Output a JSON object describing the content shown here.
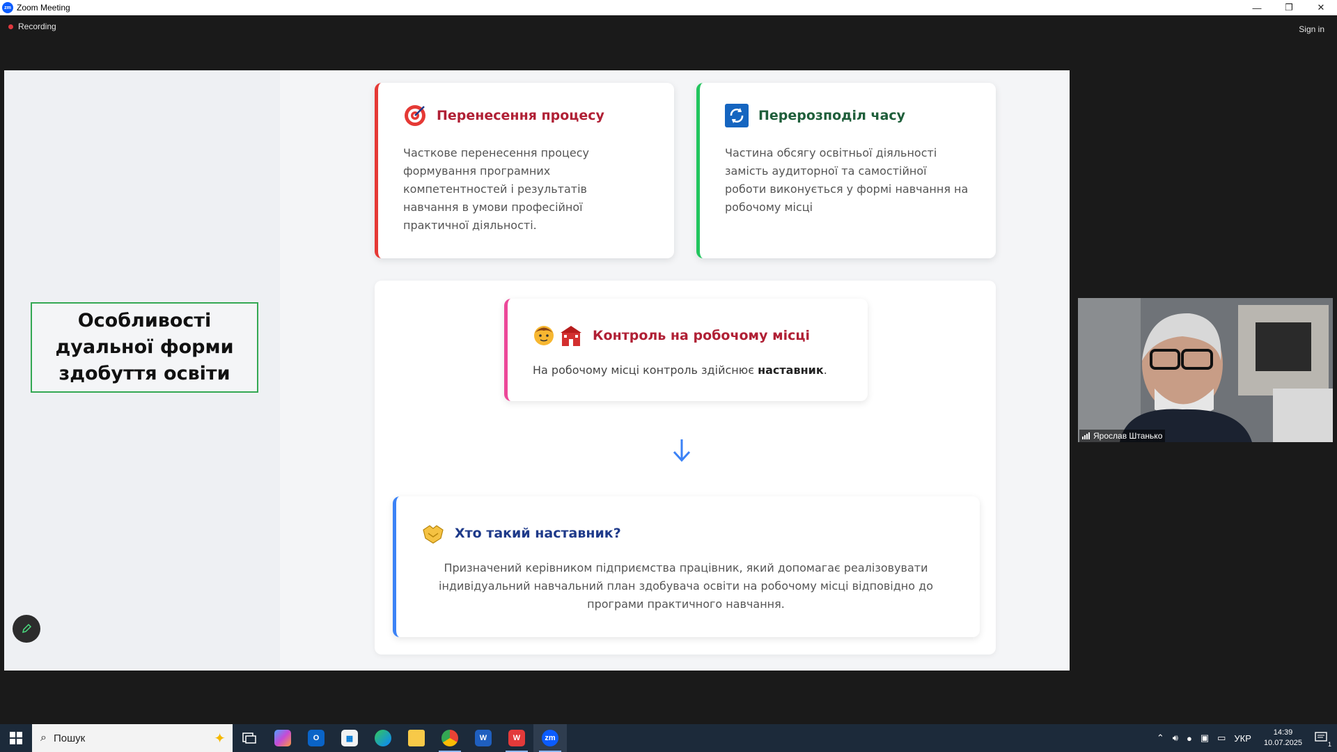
{
  "window": {
    "app_title": "Zoom Meeting",
    "logo_text": "zm",
    "minimize_label": "—",
    "restore_label": "❐",
    "close_label": "✕"
  },
  "topbar": {
    "recording_label": "Recording",
    "signin_label": "Sign in"
  },
  "slide": {
    "side_title": "Особливості дуальної форми здобуття освіти",
    "cards": [
      {
        "title": "Перенесення процесу",
        "text": "Часткове перенесення процесу формування програмних компетентностей і результатів навчання в умови професійної практичної діяльності.",
        "accent": "#e53935",
        "title_color": "#b02035"
      },
      {
        "title": "Перерозподіл часу",
        "text": "Частина обсягу освітньої діяльності замість аудиторної та самостійної роботи виконується у формі навчання на робочому місці",
        "accent": "#22c55e",
        "title_color": "#1e5e3a"
      },
      {
        "title": "Контроль на робочому місці",
        "text_before": "На робочому місці контроль здійснює ",
        "text_bold": "наставник",
        "text_after": ".",
        "accent": "#ec4899",
        "title_color": "#b02035"
      },
      {
        "title": "Хто такий наставник?",
        "text": "Призначений керівником підприємства працівник, який допомагає реалізовувати індивідуальний навчальний план здобувача освіти на робочому місці відповідно до програми практичного навчання.",
        "accent": "#3b82f6",
        "title_color": "#1e3a8a"
      }
    ]
  },
  "video": {
    "participant_name": "Ярослав Штанько"
  },
  "taskbar": {
    "search_placeholder": "Пошук",
    "language": "УКР",
    "time": "14:39",
    "date": "10.07.2025",
    "notification_count": "1"
  }
}
